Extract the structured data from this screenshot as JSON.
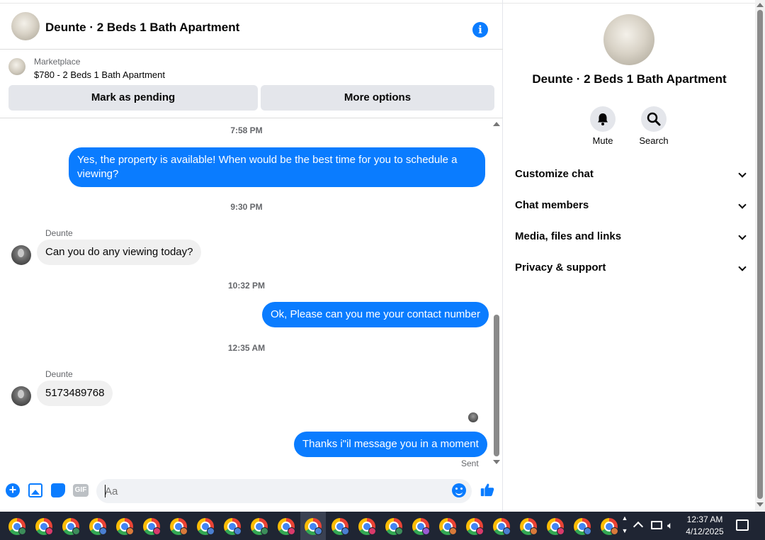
{
  "chat": {
    "title": "Deunte · 2 Beds 1 Bath Apartment",
    "listing": {
      "source": "Marketplace",
      "price_title": "$780 - 2 Beds 1 Bath Apartment",
      "mark_pending_label": "Mark as pending",
      "more_options_label": "More options"
    },
    "timestamps": [
      "7:58 PM",
      "9:30 PM",
      "10:32 PM",
      "12:35 AM"
    ],
    "messages": [
      {
        "direction": "outgoing",
        "text": "Yes, the property is available! When would be the best time for you to schedule a viewing?"
      },
      {
        "direction": "incoming",
        "sender": "Deunte",
        "text": "Can you do any viewing today?"
      },
      {
        "direction": "outgoing",
        "text": "Ok, Please can you me your contact number"
      },
      {
        "direction": "incoming",
        "sender": "Deunte",
        "text": "5173489768"
      },
      {
        "direction": "outgoing",
        "text": "Thanks i\"il message you in a moment"
      }
    ],
    "status": "Sent",
    "composer": {
      "placeholder": "Aa",
      "gif_label": "GIF"
    }
  },
  "details": {
    "title": "Deunte · 2 Beds 1 Bath Apartment",
    "actions": [
      "Mute",
      "Search"
    ],
    "sections": [
      "Customize chat",
      "Chat members",
      "Media, files and links",
      "Privacy & support"
    ]
  },
  "taskbar": {
    "time": "12:37 AM",
    "date": "4/12/2025",
    "app_icon": "chrome-icon",
    "profile_badge_colors": [
      "#3c8d5a",
      "#d93a6b",
      "#3c8d5a",
      "#4a7fd1",
      "#d97a3a",
      "#d93a6b",
      "#d97a3a",
      "#4a7fd1",
      "#4a7fd1",
      "#3c8d5a",
      "#d93a6b",
      "#4a7fd1",
      "#4a7fd1",
      "#d93a6b",
      "#3c8d5a",
      "#9a5ad1",
      "#d97a3a",
      "#d93a6b",
      "#4a7fd1",
      "#d97a3a",
      "#d93a6b",
      "#4a7fd1",
      "#d97a3a"
    ]
  },
  "colors": {
    "accent": "#0a7cff",
    "bubble_in": "#f0f0f0",
    "taskbar": "#1f2533"
  }
}
